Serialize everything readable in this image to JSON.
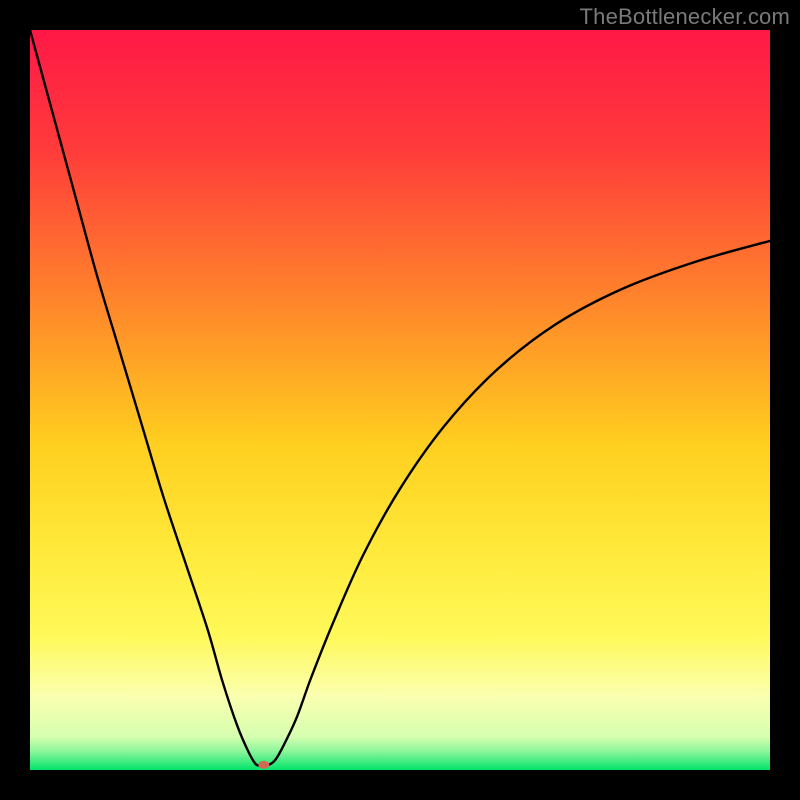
{
  "watermark": {
    "text": "TheBottlenecker.com"
  },
  "chart_data": {
    "type": "line",
    "title": "",
    "xlabel": "",
    "ylabel": "",
    "xlim": [
      0,
      100
    ],
    "ylim": [
      0,
      100
    ],
    "grid": false,
    "background_gradient": {
      "stops": [
        {
          "pos": 0,
          "color": "#ff1846"
        },
        {
          "pos": 0.16,
          "color": "#ff3b3b"
        },
        {
          "pos": 0.38,
          "color": "#ff8a2a"
        },
        {
          "pos": 0.56,
          "color": "#ffcf1f"
        },
        {
          "pos": 0.7,
          "color": "#ffe93a"
        },
        {
          "pos": 0.82,
          "color": "#fff95a"
        },
        {
          "pos": 0.9,
          "color": "#fbffb0"
        },
        {
          "pos": 0.955,
          "color": "#d6ffb0"
        },
        {
          "pos": 0.975,
          "color": "#8bf59a"
        },
        {
          "pos": 1.0,
          "color": "#00e46a"
        }
      ]
    },
    "series": [
      {
        "name": "bottleneck-curve",
        "x": [
          0,
          3,
          6,
          9,
          12,
          15,
          18,
          21,
          24,
          26,
          28,
          29.5,
          30.5,
          31.2,
          32,
          33,
          34,
          36,
          38,
          41,
          45,
          50,
          56,
          63,
          71,
          80,
          90,
          100
        ],
        "y": [
          100,
          89,
          78,
          67,
          57,
          47,
          37,
          28,
          19,
          12,
          6,
          2.5,
          0.8,
          0.6,
          0.6,
          1.2,
          2.8,
          7,
          12.5,
          20,
          29,
          38,
          46.5,
          54,
          60.2,
          65,
          68.7,
          71.5
        ]
      }
    ],
    "markers": [
      {
        "name": "optimum-dot",
        "x": 31.6,
        "y": 0.7,
        "color": "#d06a55",
        "rx": 5.5,
        "ry": 4
      }
    ]
  }
}
